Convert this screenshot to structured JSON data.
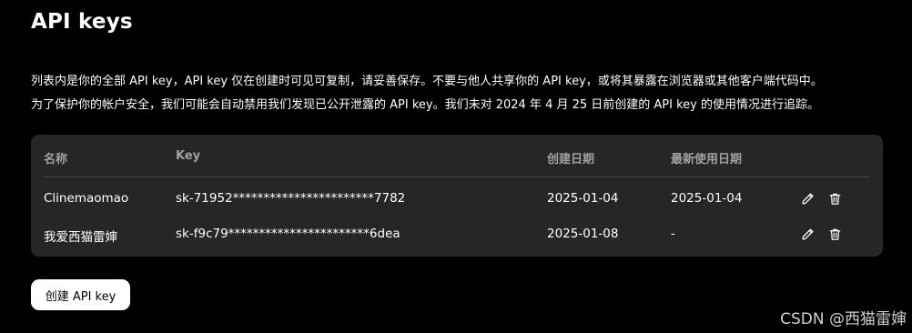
{
  "page": {
    "title": "API keys",
    "description_line1": "列表内是你的全部 API key，API key 仅在创建时可见可复制，请妥善保存。不要与他人共享你的 API key，或将其暴露在浏览器或其他客户端代码中。",
    "description_line2": "为了保护你的帐户安全，我们可能会自动禁用我们发现已公开泄露的 API key。我们未对 2024 年 4 月 25 日前创建的 API key 的使用情况进行追踪。"
  },
  "table": {
    "headers": {
      "name": "名称",
      "key": "Key",
      "created": "创建日期",
      "last_used": "最新使用日期"
    },
    "rows": [
      {
        "name": "Clinemaomao",
        "key": "sk-71952***********************7782",
        "created": "2025-01-04",
        "last_used": "2025-01-04"
      },
      {
        "name": "我爱西猫雷婶",
        "key": "sk-f9c79***********************6dea",
        "created": "2025-01-08",
        "last_used": "-"
      }
    ]
  },
  "actions": {
    "create_label": "创建 API key"
  },
  "icons": {
    "edit": "pencil-icon",
    "delete": "trash-icon"
  },
  "watermark": "CSDN @西猫雷婶"
}
